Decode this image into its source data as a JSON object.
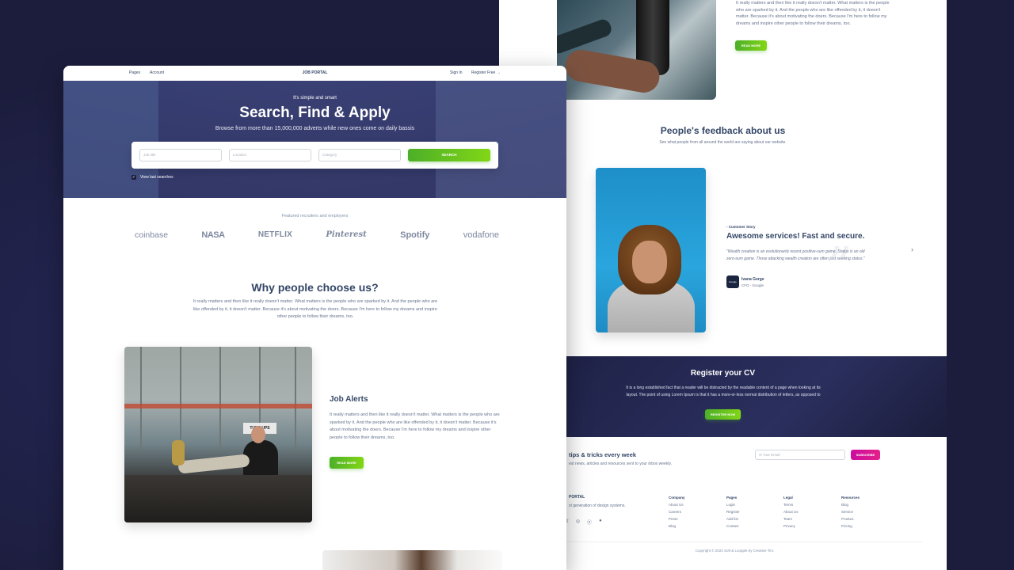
{
  "back": {
    "top_text": "It really matters and then like it really doesn't matter. What matters is the people who are sparked by it. And the people who are like offended by it, it doesn't matter. Because it's about motivating the doers. Because I'm here to follow my dreams and inspire other people to follow their dreams, too.",
    "top_read_more": "READ MORE",
    "feedback_title": "People's feedback about us",
    "feedback_subtitle": "See what people from all around the world are saying about our website.",
    "story_tag": "- Customer Story",
    "story_title": "Awesome services! Fast and secure.",
    "story_quote": "\"Wealth creation is an evolutionarily recent positive-sum game. Status is an old zero-sum game. Those attacking wealth creation are often just seeking status.\"",
    "author_logo": "Google",
    "author_name": "Ivana Gerge",
    "author_role": "CFO - Google",
    "next_icon": "chevron-right-icon",
    "register_title": "Register your CV",
    "register_desc": "It is a long established fact that a reader will be distracted by the readable content of a page when looking at its layout. The point of using Lorem Ipsum is that it has a more-or-less normal distribution of letters, as opposed to",
    "register_button": "REGISTER NOW",
    "tips_title": "tips & tricks every week",
    "tips_sub": "est news, articles and resources sent to your inbox weekly.",
    "email_placeholder": "Your Email",
    "subscribe_button": "SUBSCRIBE",
    "footer_brand": "PORTAL",
    "footer_brand_desc": "xt generation of design systems.",
    "footer_cols": [
      {
        "heading": "Company",
        "links": [
          "About Us",
          "Careers",
          "Press",
          "Blog"
        ]
      },
      {
        "heading": "Pages",
        "links": [
          "Login",
          "Register",
          "Add list",
          "Contact"
        ]
      },
      {
        "heading": "Legal",
        "links": [
          "Terms",
          "About Us",
          "Team",
          "Privacy"
        ]
      },
      {
        "heading": "Resources",
        "links": [
          "Blog",
          "Service",
          "Product",
          "Pricing"
        ]
      }
    ],
    "copyright": "Copyright © 2022 Soft & Loopple by Creative Tim."
  },
  "front": {
    "nav": {
      "pages": "Pages",
      "account": "Account",
      "brand": "JOB PORTAL",
      "signin": "Sign In",
      "register": "Register Free"
    },
    "hero": {
      "tag": "It's simple and smart",
      "title": "Search, Find & Apply",
      "subtitle": "Browse from more than 15,000,000 adverts while new ones come on daily bassis",
      "job_title_placeholder": "Job title",
      "location_placeholder": "Location",
      "category_placeholder": "Category",
      "search_button": "SEARCH",
      "view_last": "View last searches"
    },
    "featured_label": "Featured recruiters and employers",
    "logos": [
      "coinbase",
      "NASA",
      "NETFLIX",
      "Pinterest",
      "Spotify",
      "vodafone"
    ],
    "why_title": "Why people choose us?",
    "why_desc": "It really matters and then like it really doesn't matter. What matters is the people who are sparked by it. And the people who are like offended by it, it doesn't matter. Because it's about motivating the doers. Because I'm here to follow my dreams and inspire other people to follow their dreams, too.",
    "photo_sign": "TUNE UPS",
    "job_alerts_title": "Job Alerts",
    "job_alerts_desc": "It really matters and then like it really doesn't matter. What matters is the people who are sparked by it. And the people who are like offended by it, it doesn't matter. Because it's about motivating the doers. Because I'm here to follow my dreams and inspire other people to follow their dreams, too.",
    "job_alerts_button": "READ MORE"
  }
}
